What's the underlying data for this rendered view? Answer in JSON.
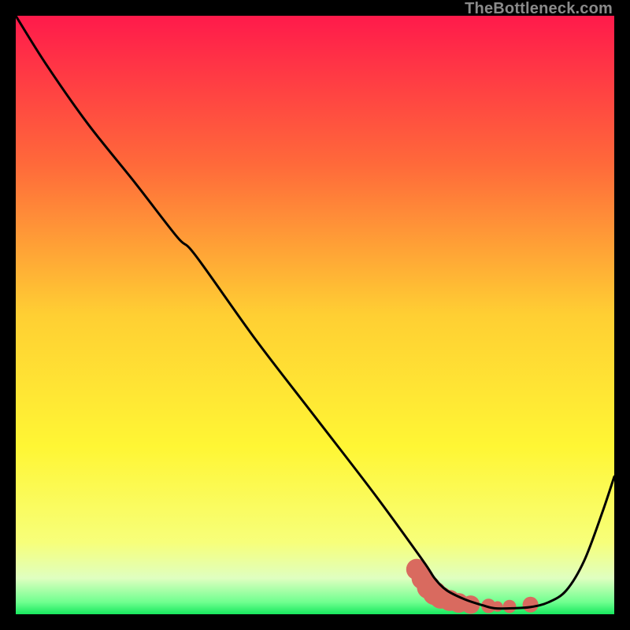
{
  "watermark": "TheBottleneck.com",
  "chart_data": {
    "type": "line",
    "title": "",
    "xlabel": "",
    "ylabel": "",
    "xlim": [
      0,
      100
    ],
    "ylim": [
      0,
      100
    ],
    "grid": false,
    "legend": false,
    "gradient_stops": [
      {
        "offset": 0.0,
        "color": "#ff1a4b"
      },
      {
        "offset": 0.25,
        "color": "#ff6a3a"
      },
      {
        "offset": 0.5,
        "color": "#ffcf33"
      },
      {
        "offset": 0.72,
        "color": "#fff634"
      },
      {
        "offset": 0.88,
        "color": "#f7ff7a"
      },
      {
        "offset": 0.94,
        "color": "#dfffc0"
      },
      {
        "offset": 0.98,
        "color": "#6fff8f"
      },
      {
        "offset": 1.0,
        "color": "#17e85e"
      }
    ],
    "series": [
      {
        "name": "bottleneck-curve",
        "color": "#000000",
        "x": [
          0,
          5,
          12,
          20,
          27,
          30,
          40,
          50,
          60,
          68,
          70,
          72,
          75,
          78,
          80,
          83,
          86,
          89,
          92,
          95,
          98,
          100
        ],
        "y": [
          100,
          92,
          82,
          72,
          63,
          60,
          46,
          33,
          20,
          9,
          6,
          4,
          2.5,
          1.5,
          1,
          1,
          1.2,
          2,
          4,
          9,
          17,
          23
        ]
      }
    ],
    "markers": {
      "name": "highlight-region",
      "color": "#d96a5f",
      "points": [
        {
          "x": 67,
          "y": 7.5,
          "r": 3.2
        },
        {
          "x": 68,
          "y": 6.0,
          "r": 3.4
        },
        {
          "x": 69,
          "y": 4.5,
          "r": 3.6
        },
        {
          "x": 70,
          "y": 3.5,
          "r": 3.6
        },
        {
          "x": 71,
          "y": 2.8,
          "r": 3.4
        },
        {
          "x": 72.5,
          "y": 2.3,
          "r": 3.2
        },
        {
          "x": 74,
          "y": 1.9,
          "r": 3.0
        },
        {
          "x": 76,
          "y": 1.6,
          "r": 2.8
        },
        {
          "x": 79,
          "y": 1.4,
          "r": 2.2
        },
        {
          "x": 80.5,
          "y": 1.3,
          "r": 1.6
        },
        {
          "x": 82.5,
          "y": 1.3,
          "r": 2.0
        },
        {
          "x": 86,
          "y": 1.6,
          "r": 2.4
        }
      ]
    }
  }
}
